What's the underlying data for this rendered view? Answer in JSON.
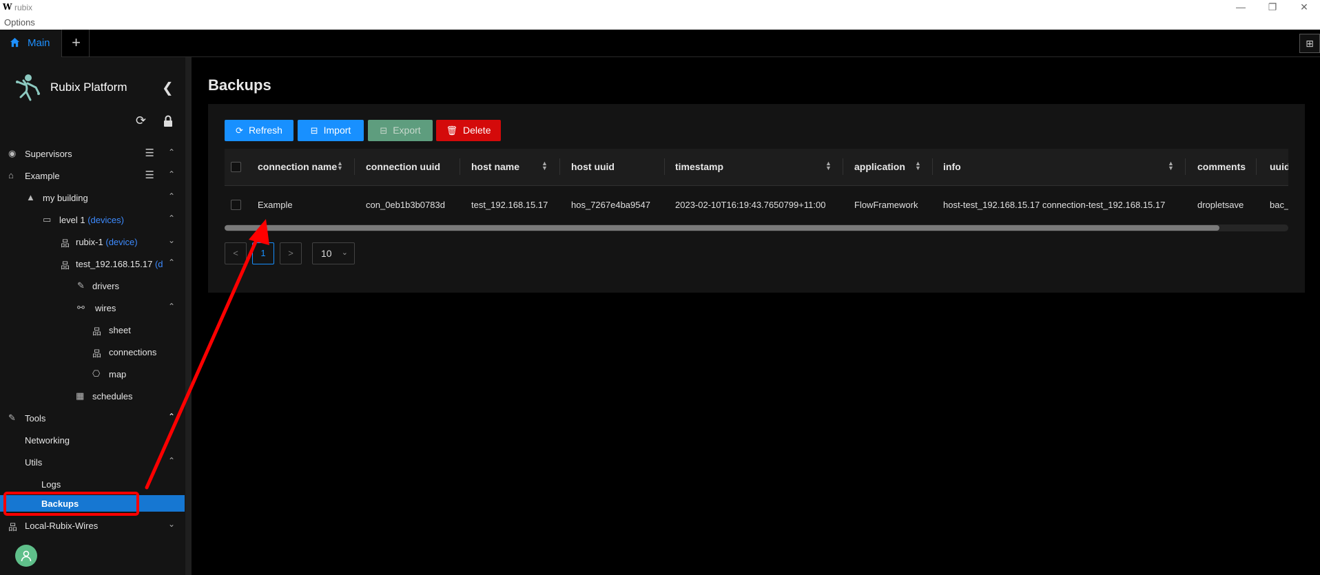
{
  "window": {
    "logo": "W",
    "title": "rubix",
    "minimize": "—",
    "restore": "❐",
    "close": "✕"
  },
  "menu": {
    "options": "Options"
  },
  "tabs": {
    "main": "Main",
    "add": "+",
    "layout": "⊞"
  },
  "brand": {
    "name": "Rubix Platform"
  },
  "sidebar": {
    "items": [
      {
        "label": "Supervisors"
      },
      {
        "label": "Example"
      },
      {
        "label": "my building"
      },
      {
        "label": "level 1",
        "suffix": "(devices)"
      },
      {
        "label": "rubix-1",
        "suffix": "(device)"
      },
      {
        "label": "test_192.168.15.17",
        "suffix": "(d"
      },
      {
        "label": "drivers"
      },
      {
        "label": "wires"
      },
      {
        "label": "sheet"
      },
      {
        "label": "connections"
      },
      {
        "label": "map"
      },
      {
        "label": "schedules"
      },
      {
        "label": "Tools"
      },
      {
        "label": "Networking"
      },
      {
        "label": "Utils"
      },
      {
        "label": "Logs"
      },
      {
        "label": "Backups"
      },
      {
        "label": "Local-Rubix-Wires"
      }
    ]
  },
  "page": {
    "title": "Backups"
  },
  "toolbar": {
    "refresh": "Refresh",
    "import": "Import",
    "export": "Export",
    "delete": "Delete"
  },
  "table": {
    "columns": [
      "connection name",
      "connection uuid",
      "host name",
      "host uuid",
      "timestamp",
      "application",
      "info",
      "comments",
      "uuid"
    ],
    "rows": [
      {
        "connection_name": "Example",
        "connection_uuid": "con_0eb1b3b0783d",
        "host_name": "test_192.168.15.17",
        "host_uuid": "hos_7267e4ba9547",
        "timestamp": "2023-02-10T16:19:43.7650799+11:00",
        "application": "FlowFramework",
        "info": "host-test_192.168.15.17 connection-test_192.168.15.17",
        "comments": "dropletsave",
        "uuid": "bac_"
      }
    ]
  },
  "pagination": {
    "prev": "<",
    "page": "1",
    "next": ">",
    "page_size": "10"
  },
  "colors": {
    "accent": "#1890ff",
    "danger": "#d40a0a",
    "annotation": "#ff0000"
  }
}
